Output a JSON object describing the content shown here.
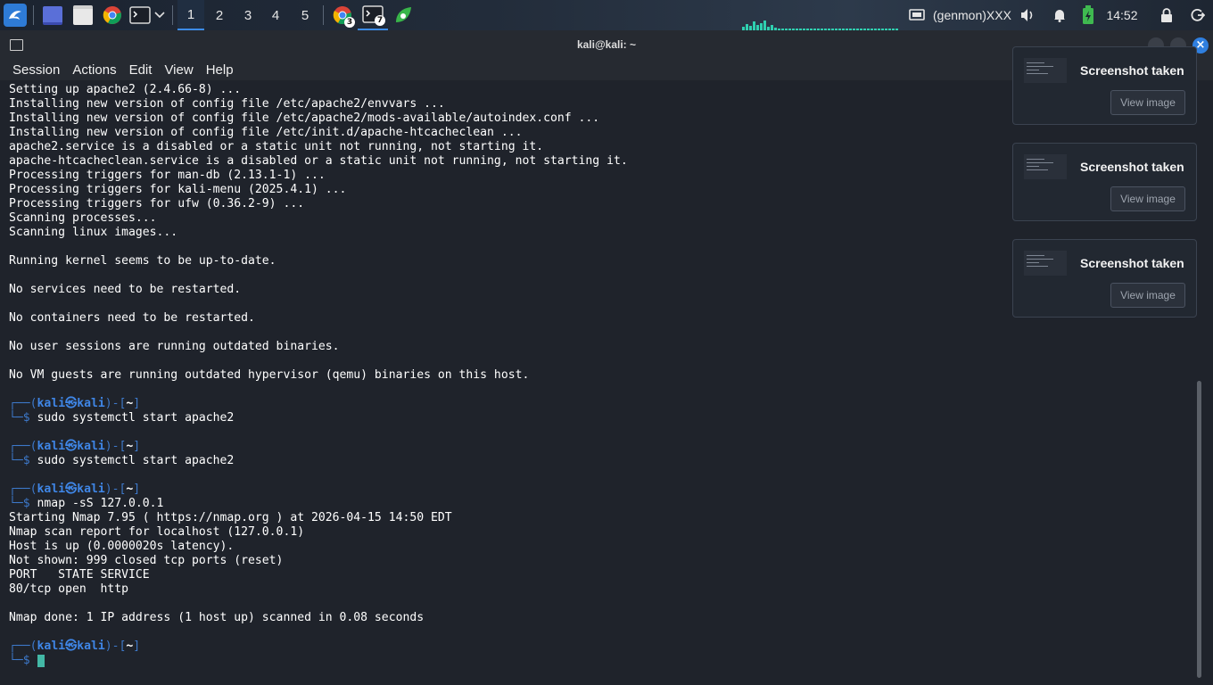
{
  "panel": {
    "workspaces": [
      "1",
      "2",
      "3",
      "4",
      "5"
    ],
    "active_workspace": "1",
    "chrome_badge": "3",
    "terminal_badge": "7",
    "genmon": "(genmon)XXX",
    "clock": "14:52"
  },
  "window": {
    "title": "kali@kali: ~",
    "menu": [
      "Session",
      "Actions",
      "Edit",
      "View",
      "Help"
    ]
  },
  "terminal": {
    "lines": [
      "Setting up apache2 (2.4.66-8) ...",
      "Installing new version of config file /etc/apache2/envvars ...",
      "Installing new version of config file /etc/apache2/mods-available/autoindex.conf ...",
      "Installing new version of config file /etc/init.d/apache-htcacheclean ...",
      "apache2.service is a disabled or a static unit not running, not starting it.",
      "apache-htcacheclean.service is a disabled or a static unit not running, not starting it.",
      "Processing triggers for man-db (2.13.1-1) ...",
      "Processing triggers for kali-menu (2025.4.1) ...",
      "Processing triggers for ufw (0.36.2-9) ...",
      "Scanning processes...",
      "Scanning linux images...",
      "",
      "Running kernel seems to be up-to-date.",
      "",
      "No services need to be restarted.",
      "",
      "No containers need to be restarted.",
      "",
      "No user sessions are running outdated binaries.",
      "",
      "No VM guests are running outdated hypervisor (qemu) binaries on this host.",
      ""
    ],
    "prompt": {
      "top_open": "┌──(",
      "user": "kali",
      "at": "㉿",
      "host": "kali",
      "mid": ")-[",
      "dir": "~",
      "close": "]",
      "bottom": "└─$"
    },
    "commands": [
      {
        "cmd": "sudo systemctl start apache2",
        "output": [
          ""
        ]
      },
      {
        "cmd": "sudo systemctl start apache2",
        "output": [
          ""
        ]
      },
      {
        "cmd": "nmap -sS 127.0.0.1",
        "output": [
          "Starting Nmap 7.95 ( https://nmap.org ) at 2026-04-15 14:50 EDT",
          "Nmap scan report for localhost (127.0.0.1)",
          "Host is up (0.0000020s latency).",
          "Not shown: 999 closed tcp ports (reset)",
          "PORT   STATE SERVICE",
          "80/tcp open  http",
          "",
          "Nmap done: 1 IP address (1 host up) scanned in 0.08 seconds",
          ""
        ]
      }
    ]
  },
  "notifications": [
    {
      "title": "Screenshot taken",
      "button": "View image"
    },
    {
      "title": "Screenshot taken",
      "button": "View image"
    },
    {
      "title": "Screenshot taken",
      "button": "View image"
    }
  ]
}
